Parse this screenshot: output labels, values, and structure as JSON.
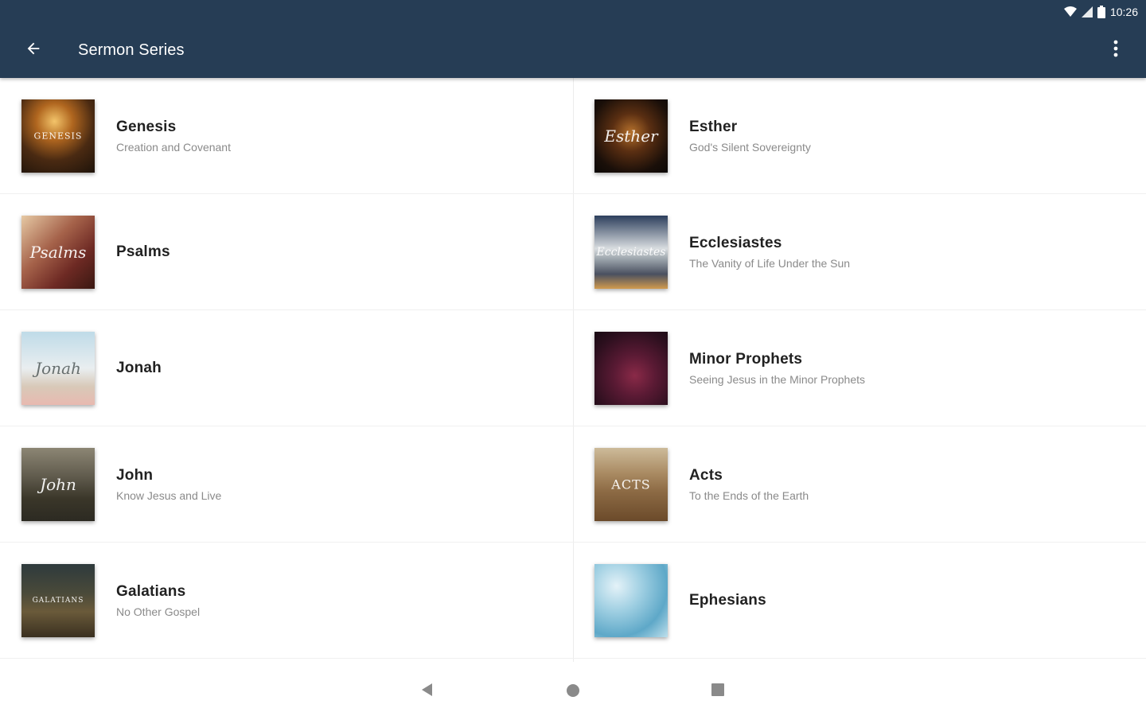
{
  "status_bar": {
    "time": "10:26",
    "icons": [
      "wifi-icon",
      "signal-icon",
      "battery-icon"
    ]
  },
  "toolbar": {
    "title": "Sermon Series",
    "back_icon": "arrow-left-icon",
    "menu_icon": "more-vert-icon"
  },
  "colors": {
    "app_bar": "#263d55",
    "title_text": "#ffffff",
    "item_title": "#212121",
    "item_subtitle": "#8a8a8a"
  },
  "series": [
    {
      "title": "Genesis",
      "subtitle": "Creation and Covenant",
      "art_text": "GENESIS"
    },
    {
      "title": "Esther",
      "subtitle": "God's Silent Sovereignty",
      "art_text": "Esther"
    },
    {
      "title": "Psalms",
      "subtitle": "",
      "art_text": "Psalms"
    },
    {
      "title": "Ecclesiastes",
      "subtitle": "The Vanity of Life Under the Sun",
      "art_text": "Ecclesiastes"
    },
    {
      "title": "Jonah",
      "subtitle": "",
      "art_text": "Jonah"
    },
    {
      "title": "Minor Prophets",
      "subtitle": "Seeing Jesus in the Minor Prophets",
      "art_text": ""
    },
    {
      "title": "John",
      "subtitle": "Know Jesus and Live",
      "art_text": "John"
    },
    {
      "title": "Acts",
      "subtitle": "To the Ends of the Earth",
      "art_text": "ACTS"
    },
    {
      "title": "Galatians",
      "subtitle": "No Other Gospel",
      "art_text": "GALATIANS"
    },
    {
      "title": "Ephesians",
      "subtitle": "",
      "art_text": ""
    }
  ],
  "nav_bar": {
    "icons": [
      "back-triangle-icon",
      "home-circle-icon",
      "recents-square-icon"
    ]
  }
}
